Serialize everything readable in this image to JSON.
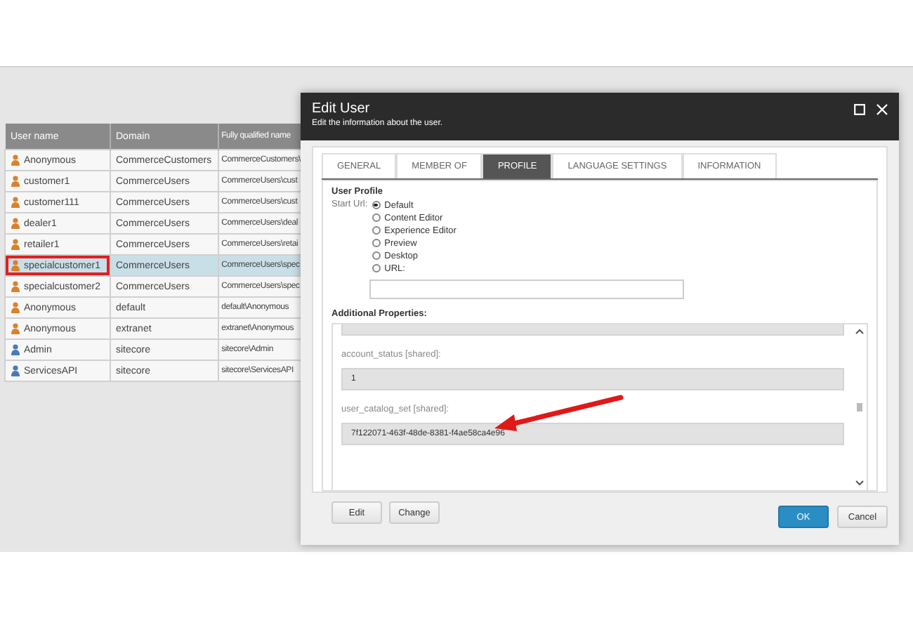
{
  "users_table": {
    "columns": [
      "User name",
      "Domain",
      "Fully qualified name"
    ],
    "rows": [
      {
        "name": "Anonymous",
        "domain": "CommerceCustomers",
        "full": "CommerceCustomers\\",
        "selected": false,
        "highlighted": false,
        "color": "#d9822b"
      },
      {
        "name": "customer1",
        "domain": "CommerceUsers",
        "full": "CommerceUsers\\cust",
        "selected": false,
        "highlighted": false,
        "color": "#d9822b"
      },
      {
        "name": "customer111",
        "domain": "CommerceUsers",
        "full": "CommerceUsers\\cust",
        "selected": false,
        "highlighted": false,
        "color": "#d9822b"
      },
      {
        "name": "dealer1",
        "domain": "CommerceUsers",
        "full": "CommerceUsers\\deal",
        "selected": false,
        "highlighted": false,
        "color": "#d9822b"
      },
      {
        "name": "retailer1",
        "domain": "CommerceUsers",
        "full": "CommerceUsers\\retai",
        "selected": false,
        "highlighted": false,
        "color": "#d9822b"
      },
      {
        "name": "specialcustomer1",
        "domain": "CommerceUsers",
        "full": "CommerceUsers\\spec",
        "selected": true,
        "highlighted": true,
        "color": "#d9822b"
      },
      {
        "name": "specialcustomer2",
        "domain": "CommerceUsers",
        "full": "CommerceUsers\\spec",
        "selected": false,
        "highlighted": false,
        "color": "#d9822b"
      },
      {
        "name": "Anonymous",
        "domain": "default",
        "full": "default\\Anonymous",
        "selected": false,
        "highlighted": false,
        "color": "#d9822b"
      },
      {
        "name": "Anonymous",
        "domain": "extranet",
        "full": "extranet\\Anonymous",
        "selected": false,
        "highlighted": false,
        "color": "#d9822b"
      },
      {
        "name": "Admin",
        "domain": "sitecore",
        "full": "sitecore\\Admin",
        "selected": false,
        "highlighted": false,
        "color": "#4a7ab8"
      },
      {
        "name": "ServicesAPI",
        "domain": "sitecore",
        "full": "sitecore\\ServicesAPI",
        "selected": false,
        "highlighted": false,
        "color": "#4a7ab8"
      }
    ]
  },
  "dialog": {
    "title": "Edit User",
    "subtitle": "Edit the information about the user.",
    "tabs": [
      {
        "label": "GENERAL",
        "selected": false
      },
      {
        "label": "MEMBER OF",
        "selected": false
      },
      {
        "label": "PROFILE",
        "selected": true
      },
      {
        "label": "LANGUAGE SETTINGS",
        "selected": false
      },
      {
        "label": "INFORMATION",
        "selected": false
      }
    ],
    "section_title": "User Profile",
    "start_url_label": "Start Url:",
    "start_url_options": [
      {
        "label": "Default",
        "selected": true
      },
      {
        "label": "Content Editor",
        "selected": false
      },
      {
        "label": "Experience Editor",
        "selected": false
      },
      {
        "label": "Preview",
        "selected": false
      },
      {
        "label": "Desktop",
        "selected": false
      },
      {
        "label": "URL:",
        "selected": false
      }
    ],
    "additional_title": "Additional Properties:",
    "properties": [
      {
        "label": "account_status [shared]:",
        "value": "1"
      },
      {
        "label": "user_catalog_set [shared]:",
        "value": "7f122071-463f-48de-8381-f4ae58ca4e96"
      }
    ],
    "property_buttons": [
      "Edit",
      "Change"
    ],
    "ok": "OK",
    "cancel": "Cancel"
  }
}
